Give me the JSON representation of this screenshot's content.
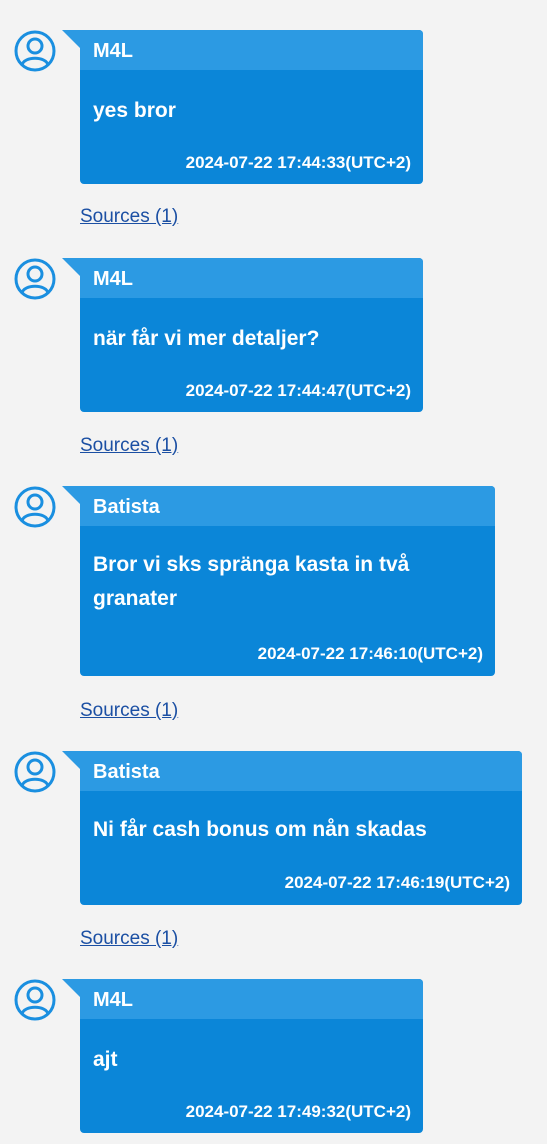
{
  "messages": [
    {
      "sender": "M4L",
      "text": "yes bror",
      "timestamp": "2024-07-22 17:44:33(UTC+2)",
      "sources": "Sources (1)"
    },
    {
      "sender": "M4L",
      "text": "när får vi mer detaljer?",
      "timestamp": "2024-07-22 17:44:47(UTC+2)",
      "sources": "Sources (1)"
    },
    {
      "sender": "Batista",
      "text": "Bror vi sks spränga kasta in två granater",
      "timestamp": "2024-07-22 17:46:10(UTC+2)",
      "sources": "Sources (1)"
    },
    {
      "sender": "Batista",
      "text": "Ni får cash bonus om nån skadas",
      "timestamp": "2024-07-22 17:46:19(UTC+2)",
      "sources": "Sources (1)"
    },
    {
      "sender": "M4L",
      "text": "ajt",
      "timestamp": "2024-07-22 17:49:32(UTC+2)"
    }
  ],
  "colors": {
    "bubble": "#0b86d8",
    "bubble_header": "#2c9ae3",
    "avatar": "#1a8fe0",
    "link": "#1b4fa3",
    "background": "#f3f3f3"
  },
  "icons": {
    "avatar": "user-avatar-icon"
  }
}
